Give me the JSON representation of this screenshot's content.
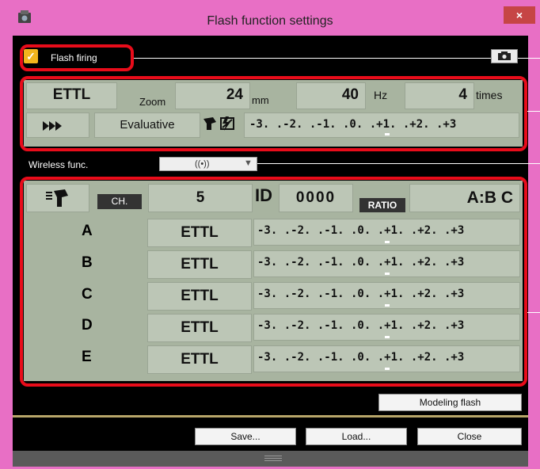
{
  "window": {
    "title": "Flash function settings",
    "close_glyph": "×"
  },
  "flash_firing": {
    "label": "Flash firing",
    "checked": true
  },
  "flash_panel": {
    "mode": "ETTL",
    "zoom_label": "Zoom",
    "zoom_value": "24",
    "zoom_unit": "mm",
    "freq_value": "40",
    "freq_unit": "Hz",
    "times_value": "4",
    "times_unit": "times",
    "metering": "Evaluative",
    "scale": "-3. .-2. .-1. .0. .+1. .+2. .+3"
  },
  "wireless": {
    "label": "Wireless func.",
    "value": "((•))"
  },
  "wireless_panel": {
    "channel_label": "CH.",
    "channel_value": "5",
    "id_label": "ID",
    "id_value": "0000",
    "ratio_label": "RATIO",
    "ratio_value": "A:B C",
    "groups": [
      {
        "name": "A",
        "mode": "ETTL",
        "scale": "-3. .-2. .-1. .0. .+1. .+2. .+3"
      },
      {
        "name": "B",
        "mode": "ETTL",
        "scale": "-3. .-2. .-1. .0. .+1. .+2. .+3"
      },
      {
        "name": "C",
        "mode": "ETTL",
        "scale": "-3. .-2. .-1. .0. .+1. .+2. .+3"
      },
      {
        "name": "D",
        "mode": "ETTL",
        "scale": "-3. .-2. .-1. .0. .+1. .+2. .+3"
      },
      {
        "name": "E",
        "mode": "ETTL",
        "scale": "-3. .-2. .-1. .0. .+1. .+2. .+3"
      }
    ]
  },
  "buttons": {
    "modeling": "Modeling flash",
    "save": "Save...",
    "load": "Load...",
    "close": "Close"
  },
  "colors": {
    "highlight": "#e80c1a",
    "panel": "#a8b4a0",
    "checkbox": "#f2b51c"
  }
}
